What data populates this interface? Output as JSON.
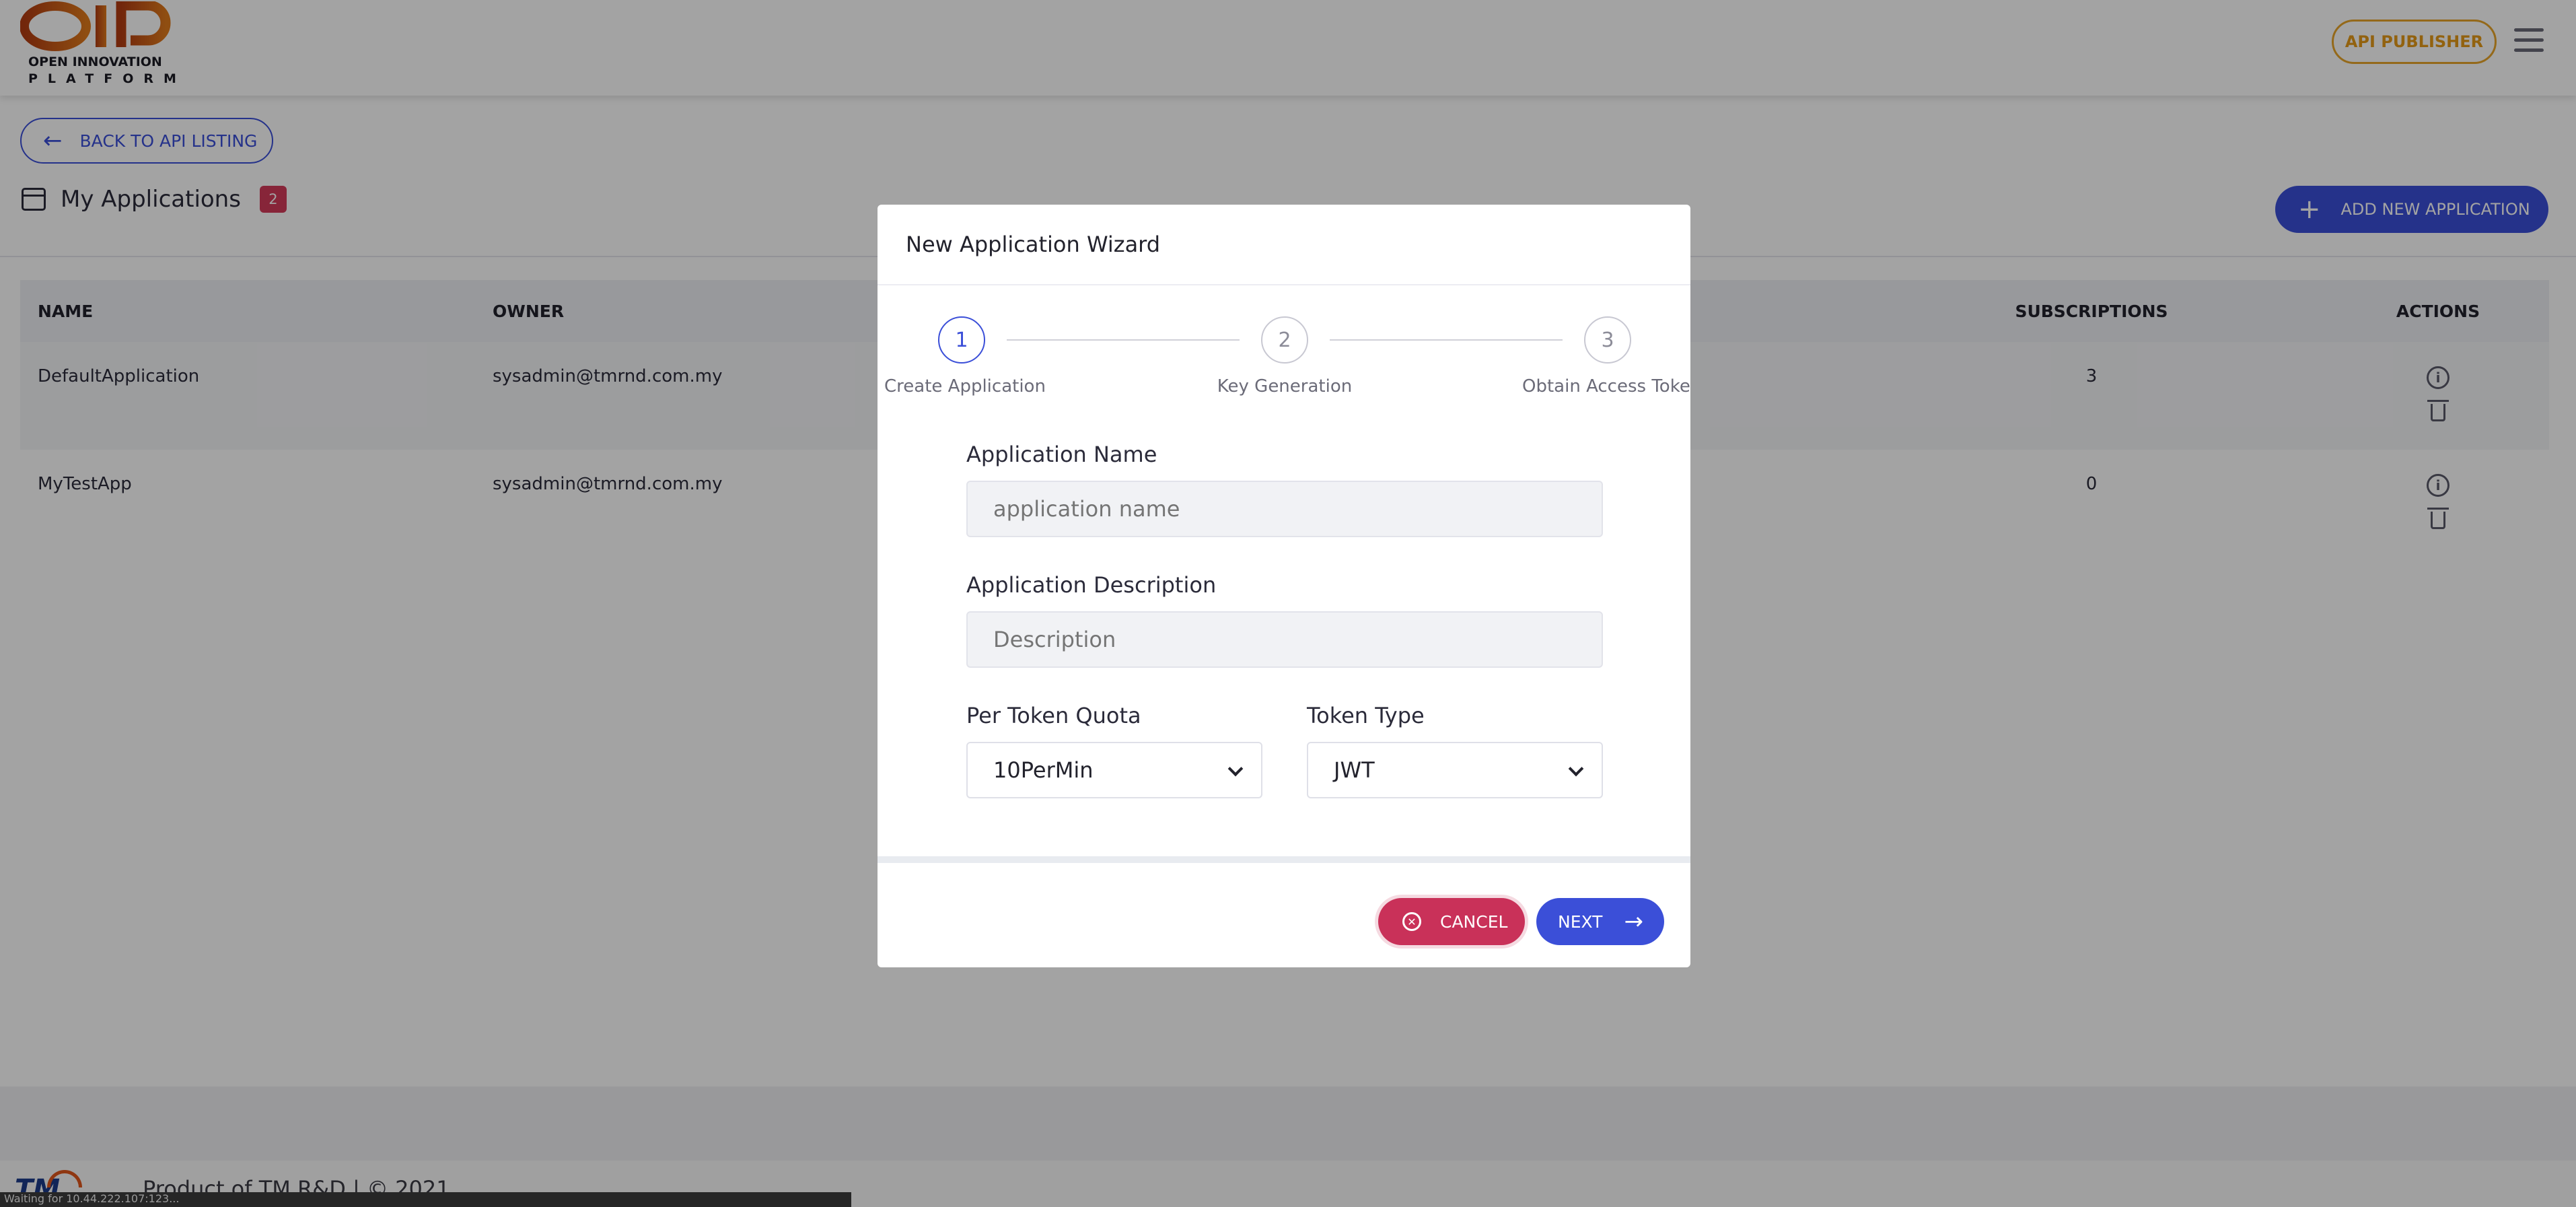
{
  "header": {
    "logo_line1": "OPEN INNOVATION",
    "logo_line2": "PLATFORM",
    "publisher_label": "API PUBLISHER"
  },
  "nav": {
    "back_label": "BACK TO API LISTING",
    "back_icon": "arrow-left-icon"
  },
  "apps": {
    "title": "My Applications",
    "count": "2",
    "add_label": "ADD NEW APPLICATION"
  },
  "table": {
    "columns": {
      "name": "NAME",
      "owner": "OWNER",
      "subscriptions": "SUBSCRIPTIONS",
      "actions": "ACTIONS"
    },
    "rows": [
      {
        "name": "DefaultApplication",
        "owner": "sysadmin@tmrnd.com.my",
        "subscriptions": "3"
      },
      {
        "name": "MyTestApp",
        "owner": "sysadmin@tmrnd.com.my",
        "subscriptions": "0"
      }
    ]
  },
  "footer": {
    "text": "Product of TM R&D | © 2021",
    "logo": "TM",
    "status_url": "Waiting for 10.44.222.107:123..."
  },
  "modal": {
    "title": "New Application Wizard",
    "steps": [
      {
        "number": "1",
        "label": "Create Application"
      },
      {
        "number": "2",
        "label": "Key Generation"
      },
      {
        "number": "3",
        "label": "Obtain Access Token"
      }
    ],
    "app_name": {
      "label": "Application Name",
      "placeholder": "application name",
      "value": ""
    },
    "app_desc": {
      "label": "Application Description",
      "placeholder": "Description",
      "value": ""
    },
    "quota": {
      "label": "Per Token Quota",
      "value": "10PerMin"
    },
    "token_type": {
      "label": "Token Type",
      "value": "JWT"
    },
    "cancel_label": "CANCEL",
    "next_label": "NEXT"
  },
  "colors": {
    "primary": "#3b4fd8",
    "danger": "#c93159",
    "publisher": "#e49a18",
    "badge": "#d43a5a"
  }
}
